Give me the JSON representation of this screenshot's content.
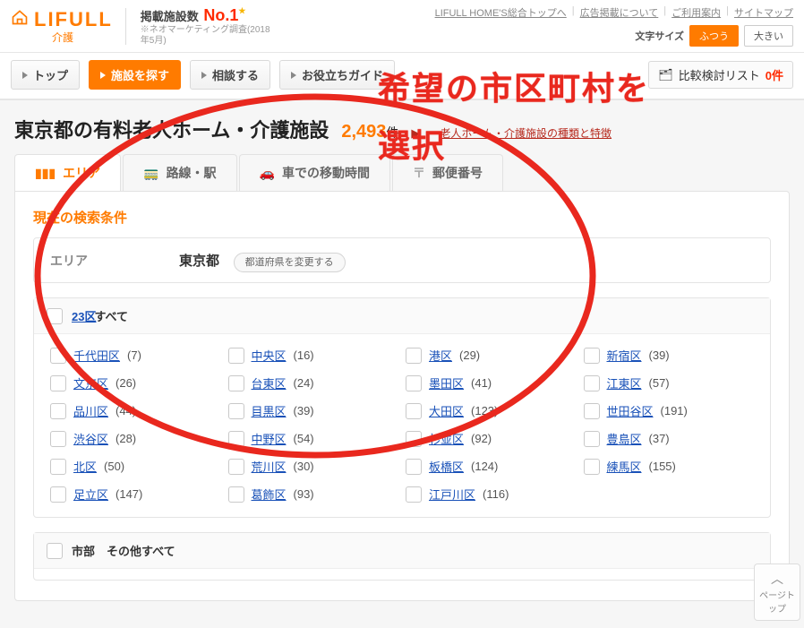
{
  "header": {
    "brand": "LIFULL",
    "brand_sub": "介護",
    "ranking_label": "掲載施設数",
    "no1": "No.1",
    "ranking_note1": "※ネオマーケティング調査(2018",
    "ranking_note2": "年5月)",
    "util": [
      "LIFULL HOME'S総合トップへ",
      "広告掲載について",
      "ご利用案内",
      "サイトマップ"
    ],
    "fontsize_label": "文字サイズ",
    "fontsize_normal": "ふつう",
    "fontsize_large": "大きい"
  },
  "nav": {
    "top": "トップ",
    "search": "施設を探す",
    "consult": "相談する",
    "guide": "お役立ちガイド",
    "compare_label": "比較検討リスト",
    "compare_count": "0件"
  },
  "title": {
    "text": "東京都の有料老人ホーム・介護施設",
    "count": "2,493",
    "unit": "件",
    "breadcrumb_link": "老人ホーム・介護施設の種類と特徴"
  },
  "tabs": {
    "area": "エリア",
    "line": "路線・駅",
    "car": "車での移動時間",
    "postal": "郵便番号"
  },
  "panel": {
    "heading": "現在の検索条件",
    "area_label": "エリア",
    "area_value": "東京都",
    "change_pref": "都道府県を変更する",
    "group_link": "23区",
    "group_tail": "すべて",
    "city_group": "市部　その他すべて"
  },
  "wards": [
    {
      "name": "千代田区",
      "count": 7
    },
    {
      "name": "中央区",
      "count": 16
    },
    {
      "name": "港区",
      "count": 29
    },
    {
      "name": "新宿区",
      "count": 39
    },
    {
      "name": "文京区",
      "count": 26
    },
    {
      "name": "台東区",
      "count": 24
    },
    {
      "name": "墨田区",
      "count": 41
    },
    {
      "name": "江東区",
      "count": 57
    },
    {
      "name": "品川区",
      "count": 44
    },
    {
      "name": "目黒区",
      "count": 39
    },
    {
      "name": "大田区",
      "count": 123
    },
    {
      "name": "世田谷区",
      "count": 191
    },
    {
      "name": "渋谷区",
      "count": 28
    },
    {
      "name": "中野区",
      "count": 54
    },
    {
      "name": "杉並区",
      "count": 92
    },
    {
      "name": "豊島区",
      "count": 37
    },
    {
      "name": "北区",
      "count": 50
    },
    {
      "name": "荒川区",
      "count": 30
    },
    {
      "name": "板橋区",
      "count": 124
    },
    {
      "name": "練馬区",
      "count": 155
    },
    {
      "name": "足立区",
      "count": 147
    },
    {
      "name": "葛飾区",
      "count": 93
    },
    {
      "name": "江戸川区",
      "count": 116
    }
  ],
  "annotation": {
    "l1": "希望の市区町村を",
    "l2": "選択"
  },
  "pagetop": "ページトップ"
}
